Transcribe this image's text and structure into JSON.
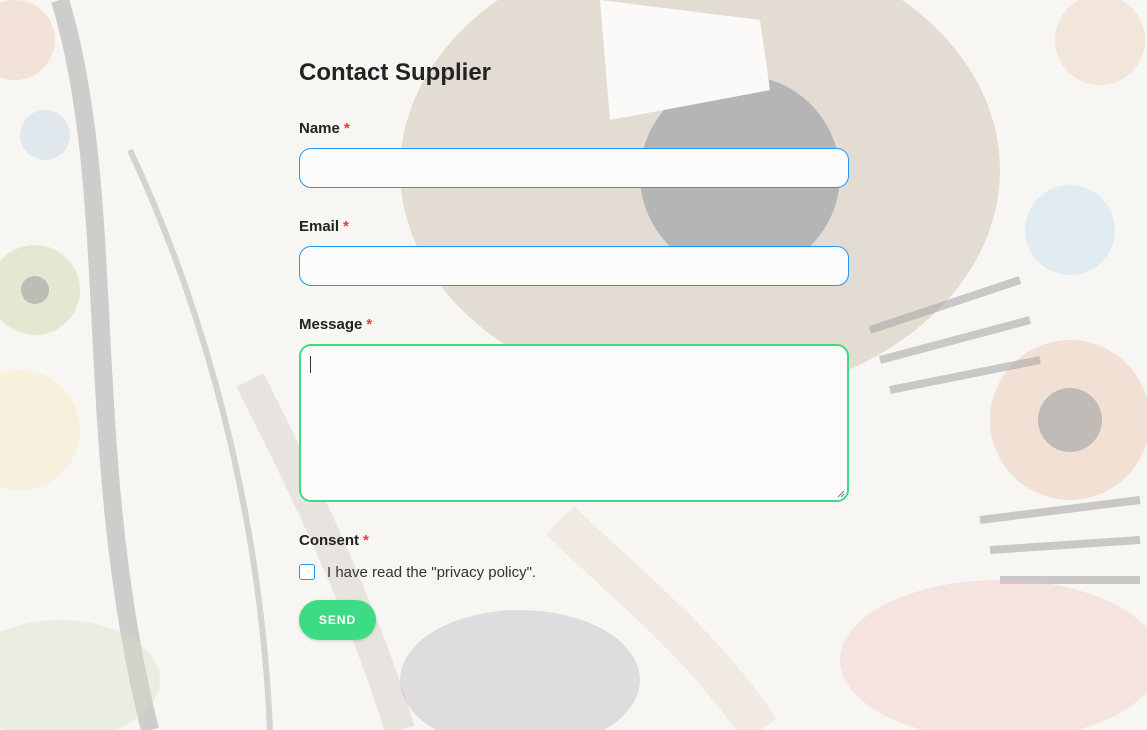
{
  "form": {
    "title": "Contact Supplier",
    "required_marker": "*",
    "name": {
      "label": "Name",
      "value": "",
      "placeholder": ""
    },
    "email": {
      "label": "Email",
      "value": "",
      "placeholder": ""
    },
    "message": {
      "label": "Message",
      "value": "",
      "placeholder": ""
    },
    "consent": {
      "label": "Consent",
      "text": "I have read the \"privacy policy\".",
      "checked": false
    },
    "send_label": "SEND"
  },
  "colors": {
    "accent_green": "#3ddc84",
    "focus_blue": "#2196f3",
    "required_red": "#e53935"
  }
}
